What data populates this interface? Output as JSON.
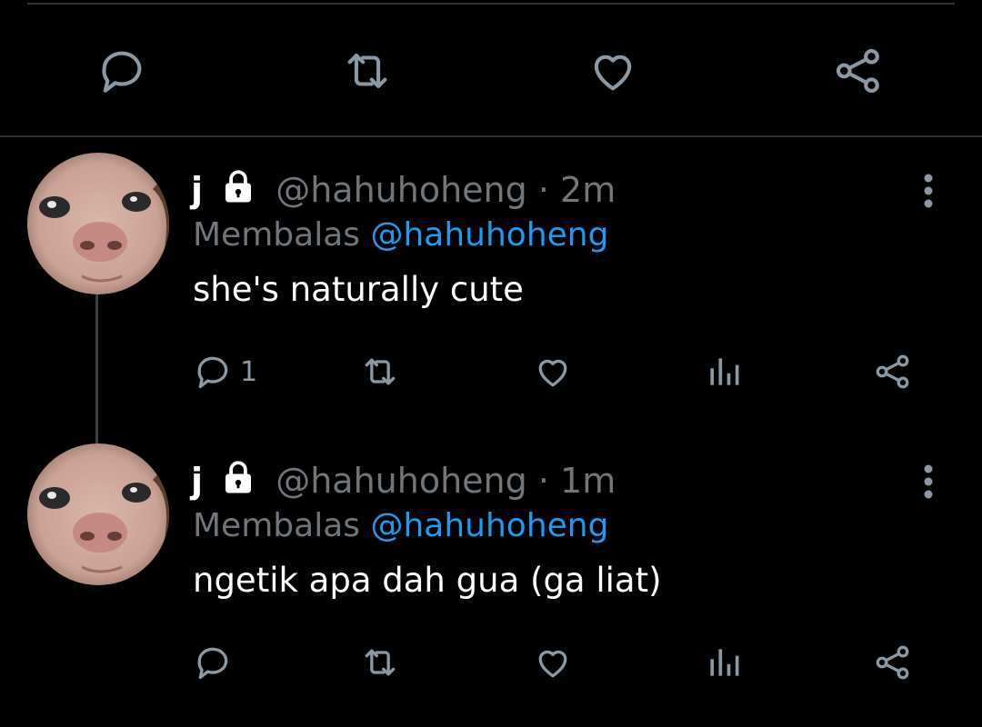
{
  "colors": {
    "background": "#000000",
    "divider": "#2f3336",
    "text_primary": "#ffffff",
    "text_secondary": "#71767b",
    "link": "#1d9bf0",
    "icon": "#8b98a5"
  },
  "top_actions": {
    "icons": [
      "reply-icon",
      "retweet-icon",
      "like-icon",
      "share-icon"
    ]
  },
  "tweets": [
    {
      "name": "j",
      "protected_icon": "lock-icon",
      "handle": "@hahuhoheng",
      "separator": "·",
      "time": "2m",
      "reply_prefix": "Membalas",
      "reply_to": "@hahuhoheng",
      "text": "she's naturally cute",
      "reply_count": "1",
      "icons": [
        "reply-icon",
        "retweet-icon",
        "like-icon",
        "analytics-icon",
        "share-icon"
      ]
    },
    {
      "name": "j",
      "protected_icon": "lock-icon",
      "handle": "@hahuhoheng",
      "separator": "·",
      "time": "1m",
      "reply_prefix": "Membalas",
      "reply_to": "@hahuhoheng",
      "text": "ngetik apa dah gua (ga liat)",
      "reply_count": "",
      "icons": [
        "reply-icon",
        "retweet-icon",
        "like-icon",
        "analytics-icon",
        "share-icon"
      ]
    }
  ]
}
